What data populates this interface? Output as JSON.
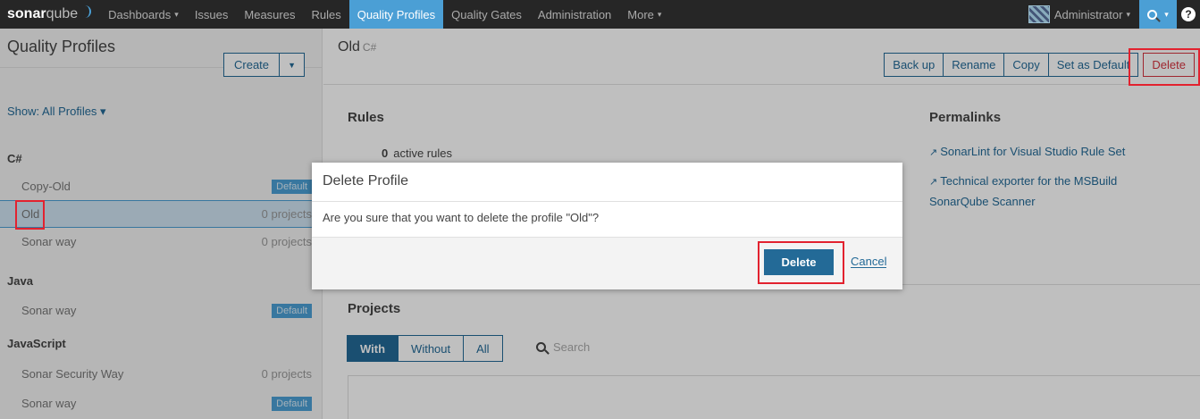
{
  "nav": {
    "logo_bold": "sonar",
    "logo_light": "qube",
    "items": [
      {
        "label": "Dashboards",
        "caret": "▾"
      },
      {
        "label": "Issues"
      },
      {
        "label": "Measures"
      },
      {
        "label": "Rules"
      },
      {
        "label": "Quality Profiles"
      },
      {
        "label": "Quality Gates"
      },
      {
        "label": "Administration"
      },
      {
        "label": "More",
        "caret": "▾"
      }
    ],
    "user": "Administrator",
    "help": "?",
    "accent": "#4b9fd5"
  },
  "sidebar": {
    "title": "Quality Profiles",
    "create_label": "Create",
    "show_label": "Show: All Profiles ▾",
    "languages": [
      {
        "name": "C#",
        "profiles": [
          {
            "name": "Copy-Old",
            "badge": "Default"
          },
          {
            "name": "Old",
            "count": "0 projects"
          },
          {
            "name": "Sonar way",
            "count": "0 projects"
          }
        ]
      },
      {
        "name": "Java",
        "profiles": [
          {
            "name": "Sonar way",
            "badge": "Default"
          }
        ]
      },
      {
        "name": "JavaScript",
        "profiles": [
          {
            "name": "Sonar Security Way",
            "count": "0 projects"
          },
          {
            "name": "Sonar way",
            "badge": "Default"
          }
        ]
      }
    ]
  },
  "profile": {
    "name": "Old",
    "language": "C#",
    "actions": {
      "backup": "Back up",
      "rename": "Rename",
      "copy": "Copy",
      "set_default": "Set as Default",
      "delete": "Delete"
    },
    "rules_title": "Rules",
    "active_count": "0",
    "active_label": "active rules",
    "permalinks_title": "Permalinks",
    "permalinks": [
      "SonarLint for Visual Studio Rule Set",
      "Technical exporter for the MSBuild",
      "SonarQube Scanner"
    ],
    "projects_title": "Projects",
    "project_tabs": [
      "With",
      "Without",
      "All"
    ],
    "search_placeholder": "Search"
  },
  "modal": {
    "title": "Delete Profile",
    "message": "Are you sure that you want to delete the profile \"Old\"?",
    "confirm": "Delete",
    "cancel": "Cancel"
  }
}
